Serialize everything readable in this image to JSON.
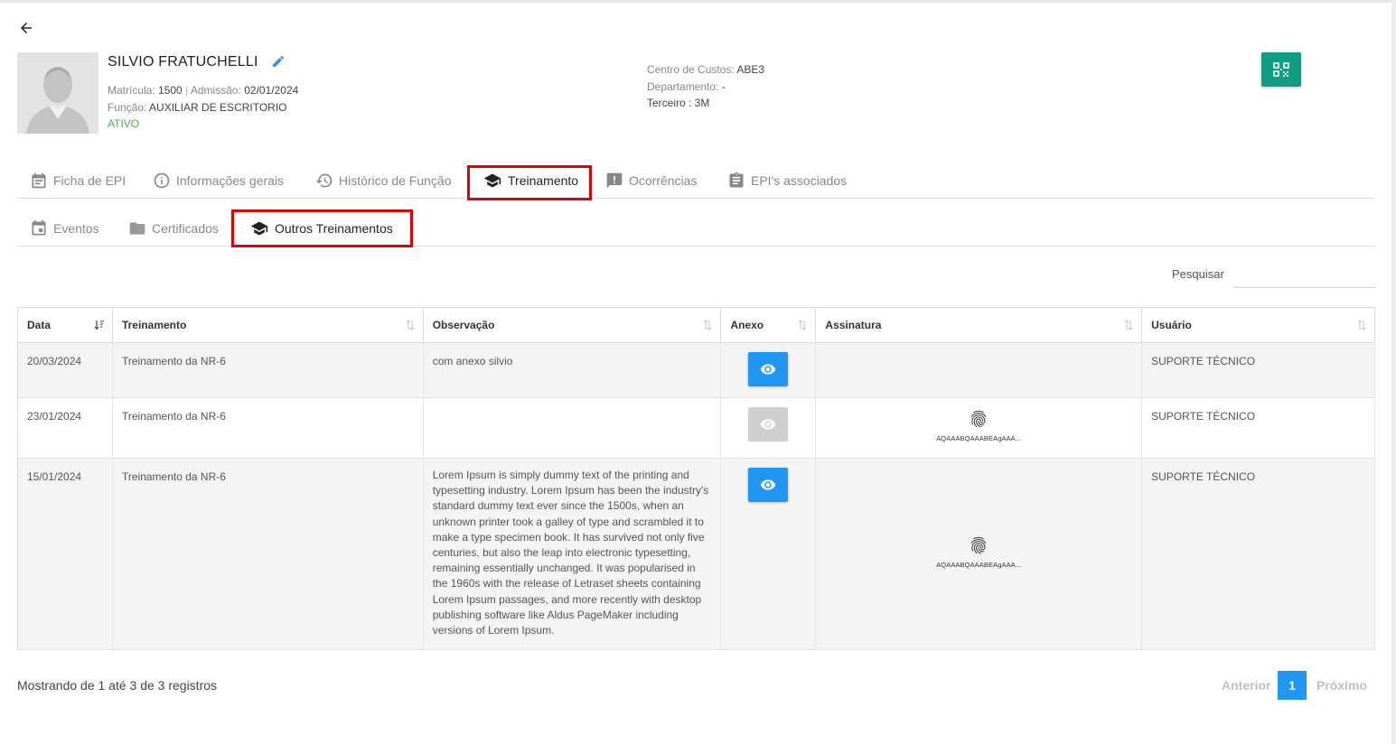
{
  "employee": {
    "name": "SILVIO FRATUCHELLI",
    "matricula_label": "Matrícula:",
    "matricula": "1500",
    "sep": "|",
    "admissao_label": "Admissão:",
    "admissao": "02/01/2024",
    "funcao_label": "Função:",
    "funcao": "AUXILIAR DE ESCRITORIO",
    "status": "ATIVO",
    "centro_label": "Centro de Custos:",
    "centro": "ABE3",
    "depto_label": "Departamento:",
    "depto": "-",
    "terceiro": "Terceiro : 3M"
  },
  "tabs": [
    {
      "label": "Ficha de EPI",
      "icon": "calendar-icon"
    },
    {
      "label": "Informações gerais",
      "icon": "info-icon"
    },
    {
      "label": "Histórico de Função",
      "icon": "history-icon"
    },
    {
      "label": "Treinamento",
      "icon": "graduation-cap-icon",
      "active": true
    },
    {
      "label": "Ocorrências",
      "icon": "alert-icon"
    },
    {
      "label": "EPI's associados",
      "icon": "clipboard-icon"
    }
  ],
  "subtabs": [
    {
      "label": "Eventos",
      "icon": "calendar-icon"
    },
    {
      "label": "Certificados",
      "icon": "certificate-icon"
    },
    {
      "label": "Outros Treinamentos",
      "icon": "graduation-cap-icon",
      "active": true
    }
  ],
  "search": {
    "label": "Pesquisar",
    "value": ""
  },
  "table": {
    "headers": [
      "Data",
      "Treinamento",
      "Observação",
      "Anexo",
      "Assinatura",
      "Usuário"
    ],
    "rows": [
      {
        "data": "20/03/2024",
        "treinamento": "Treinamento da NR-6",
        "observacao": "com anexo silvio",
        "anexo": true,
        "assinatura": "",
        "usuario": "SUPORTE TÉCNICO"
      },
      {
        "data": "23/01/2024",
        "treinamento": "Treinamento da NR-6",
        "observacao": "",
        "anexo": false,
        "assinatura": "AQAAABQAAABEAgAAA...",
        "usuario": "SUPORTE TÉCNICO"
      },
      {
        "data": "15/01/2024",
        "treinamento": "Treinamento da NR-6",
        "observacao": "Lorem Ipsum is simply dummy text of the printing and typesetting industry. Lorem Ipsum has been the industry's standard dummy text ever since the 1500s, when an unknown printer took a galley of type and scrambled it to make a type specimen book. It has survived not only five centuries, but also the leap into electronic typesetting, remaining essentially unchanged. It was popularised in the 1960s with the release of Letraset sheets containing Lorem Ipsum passages, and more recently with desktop publishing software like Aldus PageMaker including versions of Lorem Ipsum.",
        "anexo": true,
        "assinatura": "AQAAABQAAABEAgAAA...",
        "usuario": "SUPORTE TÉCNICO"
      }
    ]
  },
  "footer": {
    "info": "Mostrando de 1 até 3 de 3 registros",
    "prev": "Anterior",
    "page": "1",
    "next": "Próximo"
  },
  "colors": {
    "accent": "#2196f3",
    "qr_button": "#0f9d84",
    "highlight": "#e50000",
    "status": "#4caf50"
  }
}
